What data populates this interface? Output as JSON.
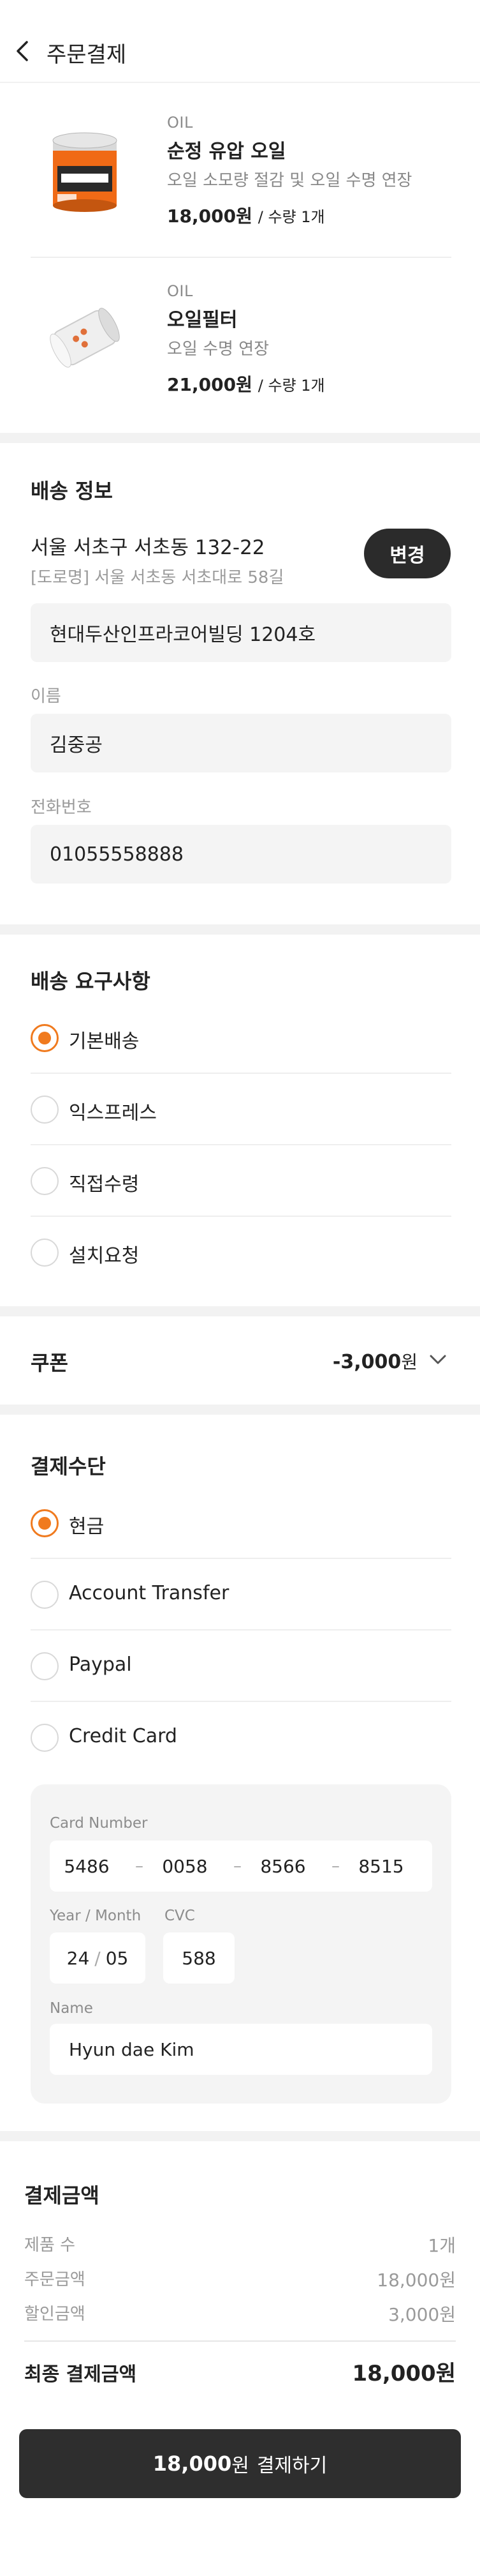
{
  "header": {
    "title": "주문결제"
  },
  "products": [
    {
      "category": "OIL",
      "name": "순정 유압 오일",
      "description": "오일 소모량 절감 및 오일 수명 연장",
      "price": "18,000",
      "won": "원",
      "quantity": "/ 수량 1개"
    },
    {
      "category": "OIL",
      "name": "오일필터",
      "description": "오일 수명 연장",
      "price": "21,000",
      "won": "원",
      "quantity": "/ 수량 1개"
    }
  ],
  "shipping": {
    "title": "배송 정보",
    "address": "서울 서초구 서초동 132-22",
    "road_address": "[도로명] 서울 서초동 서초대로 58길",
    "change_label": "변경",
    "detail_address": "현대두산인프라코어빌딩 1204호",
    "name_label": "이름",
    "name_value": "김중공",
    "phone_label": "전화번호",
    "phone_value": "01055558888"
  },
  "delivery": {
    "title": "배송 요구사항",
    "options": [
      {
        "label": "기본배송",
        "selected": true
      },
      {
        "label": "익스프레스",
        "selected": false
      },
      {
        "label": "직접수령",
        "selected": false
      },
      {
        "label": "설치요청",
        "selected": false
      }
    ]
  },
  "coupon": {
    "title": "쿠폰",
    "value": "-3,000",
    "unit": "원"
  },
  "payment": {
    "title": "결제수단",
    "options": [
      {
        "label": "현금",
        "selected": true
      },
      {
        "label": "Account Transfer",
        "selected": false
      },
      {
        "label": "Paypal",
        "selected": false
      },
      {
        "label": "Credit Card",
        "selected": false
      }
    ],
    "card": {
      "number_label": "Card Number",
      "numbers": [
        "5486",
        "0058",
        "8566",
        "8515"
      ],
      "dash": "–",
      "expiry_label": "Year / Month",
      "expiry_year": "24",
      "expiry_sep": "/",
      "expiry_month": "05",
      "cvc_label": "CVC",
      "cvc_value": "588",
      "name_label": "Name",
      "name_value": "Hyun dae Kim"
    }
  },
  "summary": {
    "title": "결제금액",
    "rows": [
      {
        "label": "제품 수",
        "value": "1개"
      },
      {
        "label": "주문금액",
        "value": "18,000원"
      },
      {
        "label": "할인금액",
        "value": "3,000원"
      }
    ],
    "final_label": "최종 결제금액",
    "final_value": "18,000원"
  },
  "pay_button": {
    "amount": "18,000",
    "unit": "원",
    "label": "결제하기"
  },
  "colors": {
    "accent": "#f07a1e",
    "dark_button": "#2b2b2b",
    "field_bg": "#f4f4f4",
    "separator": "#f2f2f2"
  },
  "icons": {
    "back": "chevron-left-icon",
    "coupon_toggle": "chevron-down-icon"
  }
}
